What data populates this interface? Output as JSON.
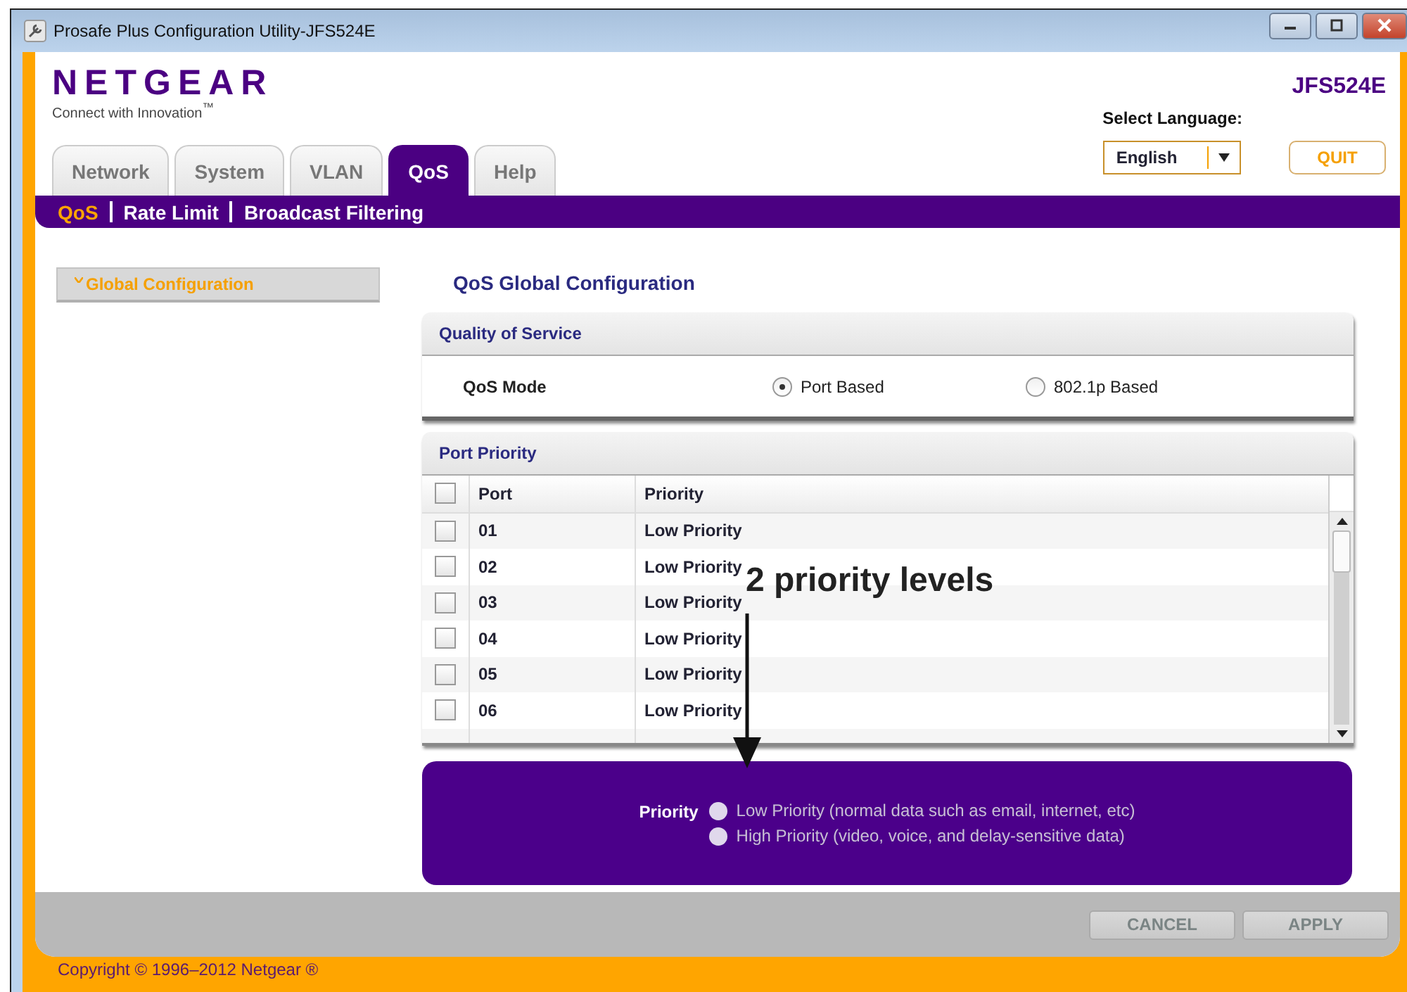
{
  "window": {
    "title": "Prosafe Plus Configuration Utility-JFS524E"
  },
  "header": {
    "logo": "NETGEAR",
    "tagline": "Connect with Innovation$^{™}$",
    "model": "JFS524E",
    "language_label": "Select Language:",
    "language": {
      "value": "English"
    },
    "quit_button": "QUIT"
  },
  "tabs": [
    {
      "label": "Network",
      "selected": false
    },
    {
      "label": "System",
      "selected": false
    },
    {
      "label": "VLAN",
      "selected": false
    },
    {
      "label": "QoS",
      "selected": true
    },
    {
      "label": "Help",
      "selected": false
    }
  ],
  "subtabs": [
    {
      "label": "QoS",
      "selected": true
    },
    {
      "label": "Rate Limit",
      "selected": false
    },
    {
      "label": "Broadcast Filtering",
      "selected": false
    }
  ],
  "sidebar": {
    "items": [
      {
        "label": "Global Configuration",
        "expanded": true
      }
    ]
  },
  "page_title": "QoS Global Configuration",
  "quality_of_service": {
    "title": "Quality of Service",
    "field_label": "QoS Mode",
    "options": [
      {
        "label": "Port Based",
        "selected": true
      },
      {
        "label": "802.1p Based",
        "selected": false
      }
    ]
  },
  "port_priority": {
    "title": "Port Priority",
    "header_checked": false,
    "columns": [
      "Port",
      "Priority"
    ],
    "rows": [
      {
        "port": "01",
        "priority": "Low Priority",
        "checked": false
      },
      {
        "port": "02",
        "priority": "Low Priority",
        "checked": false
      },
      {
        "port": "03",
        "priority": "Low Priority",
        "checked": false
      },
      {
        "port": "04",
        "priority": "Low Priority",
        "checked": false
      },
      {
        "port": "05",
        "priority": "Low Priority",
        "checked": false
      },
      {
        "port": "06",
        "priority": "Low Priority",
        "checked": false
      }
    ]
  },
  "priority_popup": {
    "label": "Priority",
    "options": [
      {
        "label": "Low Priority (normal data such as email, internet, etc)",
        "selected": false
      },
      {
        "label": "High Priority (video, voice, and delay-sensitive data)",
        "selected": false
      }
    ]
  },
  "annotation": "2 priority levels",
  "buttons": [
    {
      "label": "CANCEL",
      "disabled": true
    },
    {
      "label": "APPLY",
      "disabled": true
    }
  ],
  "footer": "Copyright © 1996–2012 Netgear ®"
}
